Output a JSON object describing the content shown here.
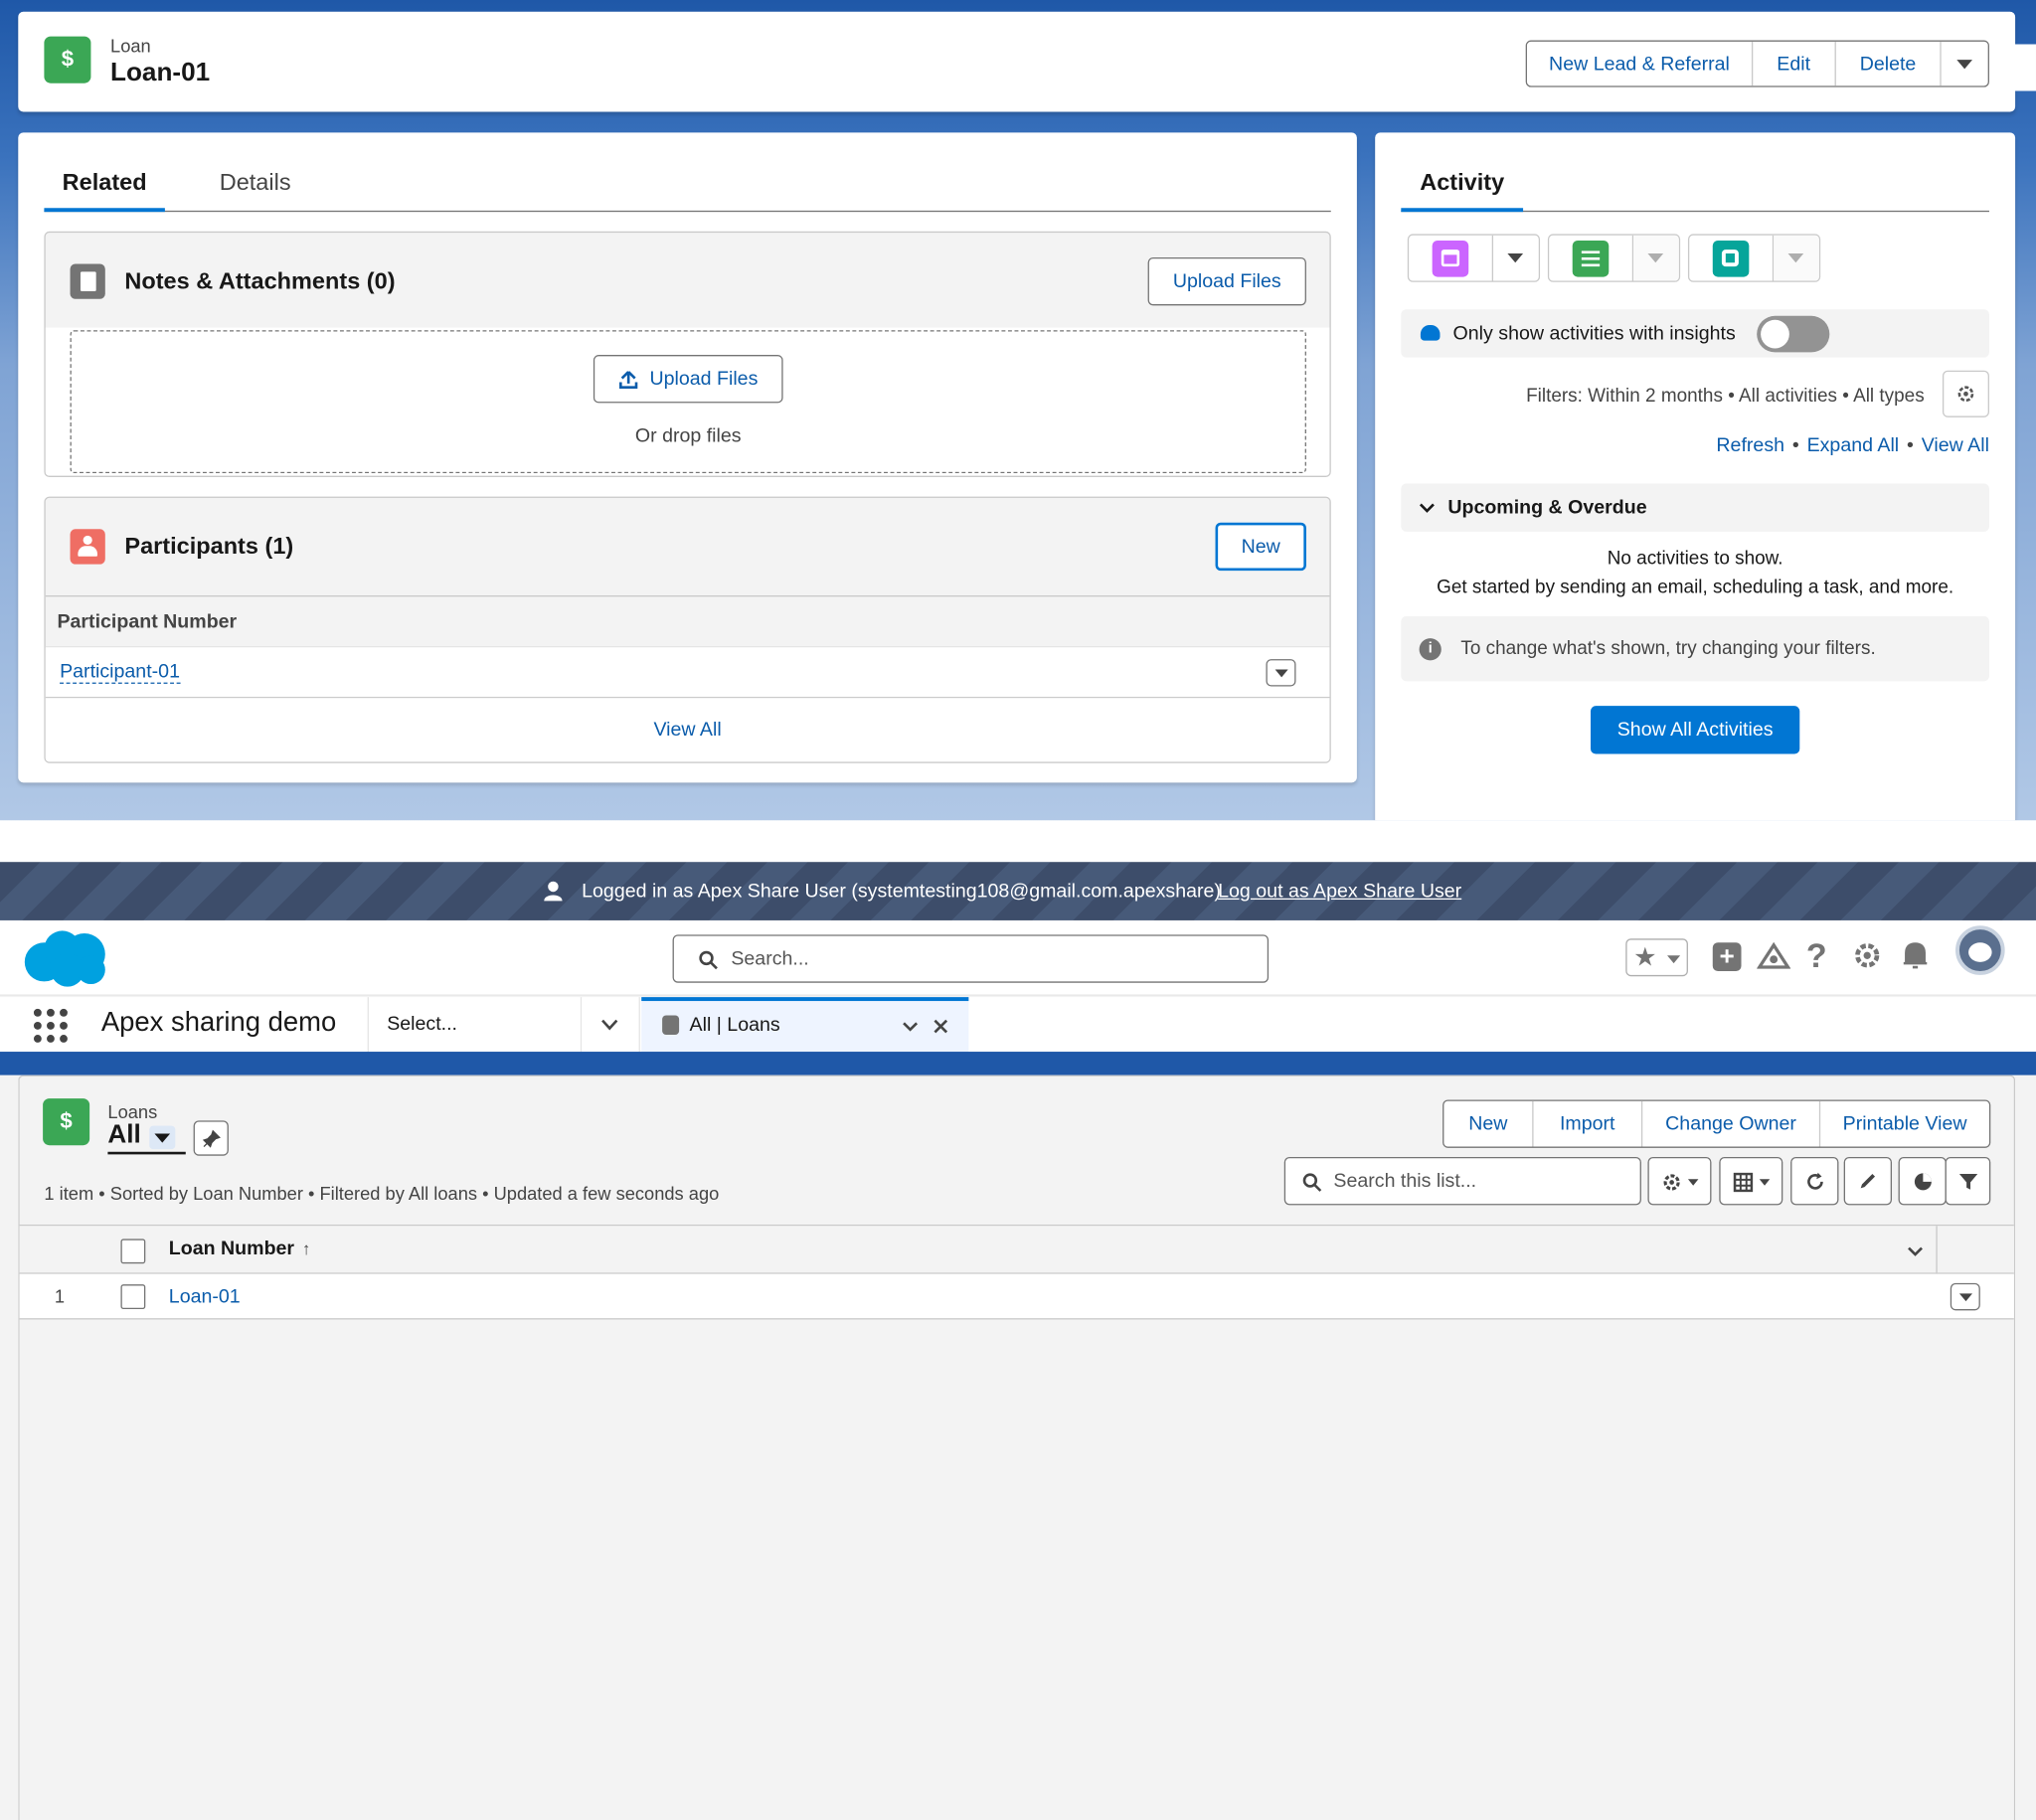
{
  "record_page": {
    "object_label": "Loan",
    "record_name": "Loan-01",
    "actions": [
      "New Lead & Referral",
      "Edit",
      "Delete"
    ],
    "tabs": {
      "related": "Related",
      "details": "Details"
    },
    "notes": {
      "title": "Notes & Attachments (0)",
      "upload_button": "Upload Files",
      "drop_upload_button": "Upload Files",
      "drop_hint": "Or drop files"
    },
    "participants": {
      "title": "Participants (1)",
      "new_button": "New",
      "column": "Participant Number",
      "rows": [
        "Participant-01"
      ],
      "view_all": "View All"
    },
    "activity": {
      "title": "Activity",
      "insights_label": "Only show activities with insights",
      "filters_text": "Filters: Within 2 months • All activities • All types",
      "links": {
        "refresh": "Refresh",
        "expand_all": "Expand All",
        "view_all": "View All"
      },
      "upcoming_title": "Upcoming & Overdue",
      "empty_line1": "No activities to show.",
      "empty_line2": "Get started by sending an email, scheduling a task, and more.",
      "info_text": "To change what's shown, try changing your filters.",
      "show_all_button": "Show All Activities"
    }
  },
  "list_page": {
    "banner_text": "Logged in as Apex Share User (systemtesting108@gmail.com.apexshare)",
    "banner_logout": "Log out as Apex Share User",
    "search_placeholder": "Search...",
    "app_name": "Apex sharing demo",
    "nav_select": "Select...",
    "open_tab": "All | Loans",
    "object_plural": "Loans",
    "list_view": "All",
    "actions": [
      "New",
      "Import",
      "Change Owner",
      "Printable View"
    ],
    "list_search_placeholder": "Search this list...",
    "status_text": "1 item • Sorted by Loan Number • Filtered by All loans • Updated a few seconds ago",
    "column": "Loan Number",
    "rows": [
      {
        "num": "1",
        "name": "Loan-01"
      }
    ]
  },
  "colors": {
    "brand": "#0176d3",
    "link": "#0b5cab",
    "loan_green": "#3ba755",
    "participant_red": "#ef6e64",
    "event_purple": "#cb65ff",
    "task_green": "#3ba755",
    "call_teal": "#06a59a"
  }
}
